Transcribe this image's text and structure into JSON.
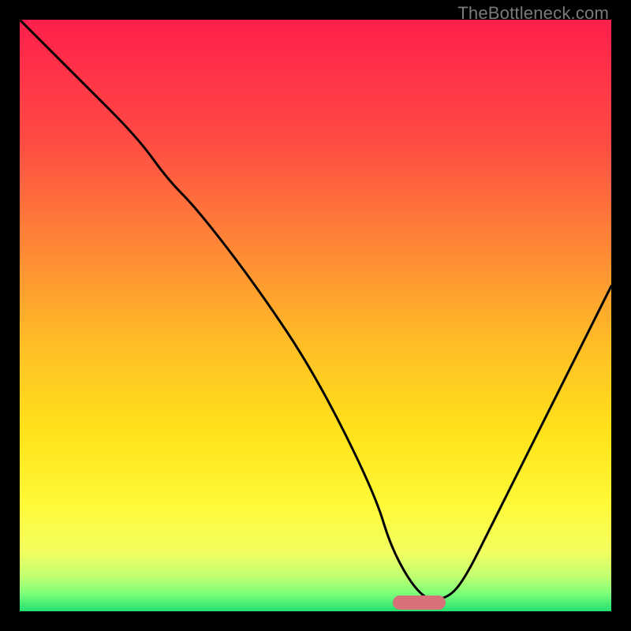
{
  "watermark": "TheBottleneck.com",
  "chart_data": {
    "type": "line",
    "title": "",
    "xlabel": "",
    "ylabel": "",
    "xlim": [
      0,
      100
    ],
    "ylim": [
      0,
      100
    ],
    "series": [
      {
        "name": "bottleneck-curve",
        "x": [
          0,
          10,
          20,
          25,
          30,
          40,
          50,
          60,
          63,
          68,
          72,
          75,
          80,
          90,
          100
        ],
        "values": [
          100,
          90,
          80,
          73,
          68,
          55,
          40,
          20,
          10,
          2,
          2,
          5,
          15,
          35,
          55
        ]
      }
    ],
    "optimum_marker": {
      "x_start": 63,
      "x_end": 72,
      "y": 1.5
    },
    "gradient": {
      "stops": [
        {
          "pos": 0.0,
          "color": "#ff1f4b"
        },
        {
          "pos": 0.2,
          "color": "#ff4a44"
        },
        {
          "pos": 0.4,
          "color": "#ff8d35"
        },
        {
          "pos": 0.55,
          "color": "#ffbe26"
        },
        {
          "pos": 0.7,
          "color": "#ffe31a"
        },
        {
          "pos": 0.82,
          "color": "#fff938"
        },
        {
          "pos": 0.9,
          "color": "#f2ff60"
        },
        {
          "pos": 0.94,
          "color": "#c2ff70"
        },
        {
          "pos": 0.97,
          "color": "#7dff7a"
        },
        {
          "pos": 1.0,
          "color": "#22e070"
        }
      ]
    }
  }
}
